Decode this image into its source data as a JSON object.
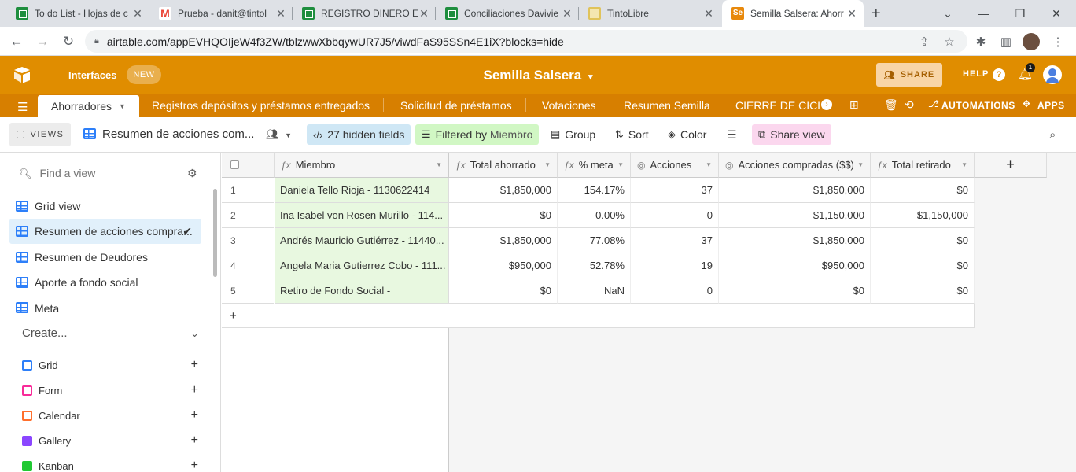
{
  "browser": {
    "tabs": [
      {
        "title": "To do List - Hojas de c",
        "favicon": "sheets-icon"
      },
      {
        "title": "Prueba - danit@tintol",
        "favicon": "gmail-icon"
      },
      {
        "title": "REGISTRO DINERO EN",
        "favicon": "sheets-icon"
      },
      {
        "title": "Conciliaciones Davivie",
        "favicon": "sheets-icon"
      },
      {
        "title": "TintoLibre",
        "favicon": "tintolibre-icon"
      },
      {
        "title": "Semilla Salsera: Ahorr",
        "favicon": "airtable-se-icon"
      }
    ],
    "new_tab": "+",
    "url": "airtable.com/appEVHQOIjeW4f3ZW/tblzwwXbbqywUR7J5/viwdFaS95SSn4E1iX?blocks=hide"
  },
  "header": {
    "interfaces": "Interfaces",
    "new_badge": "NEW",
    "base_title": "Semilla Salsera",
    "base_caret": "▾",
    "share": "SHARE",
    "help": "HELP",
    "notification_count": "1"
  },
  "tables": {
    "active": "Ahorradores",
    "items": [
      "Registros depósitos y préstamos entregados",
      "Solicitud de préstamos",
      "Votaciones",
      "Resumen Semilla",
      "CIERRE DE CICLO"
    ],
    "automations": "AUTOMATIONS",
    "apps": "APPS"
  },
  "viewbar": {
    "views": "VIEWS",
    "view_name": "Resumen de acciones com...",
    "hidden_fields": "27 hidden fields",
    "filtered_prefix": "Filtered by",
    "filtered_field": "Miembro",
    "group": "Group",
    "sort": "Sort",
    "color": "Color",
    "share_view": "Share view"
  },
  "sidebar": {
    "find_placeholder": "Find a view",
    "views": [
      {
        "label": "Grid view",
        "active": false
      },
      {
        "label": "Resumen de acciones compra...",
        "active": true
      },
      {
        "label": "Resumen de Deudores",
        "active": false
      },
      {
        "label": "Aporte a fondo social",
        "active": false
      },
      {
        "label": "Meta",
        "active": false
      }
    ],
    "create_label": "Create...",
    "create_items": [
      {
        "label": "Grid",
        "color": "#2d7ff9"
      },
      {
        "label": "Form",
        "color": "#f82b99"
      },
      {
        "label": "Calendar",
        "color": "#ff6f2c"
      },
      {
        "label": "Gallery",
        "color": "#8b46ff"
      },
      {
        "label": "Kanban",
        "color": "#20c933"
      }
    ]
  },
  "grid": {
    "columns": [
      {
        "name": "Miembro",
        "type": "formula"
      },
      {
        "name": "Total ahorrado",
        "type": "formula"
      },
      {
        "name": "% meta",
        "type": "formula"
      },
      {
        "name": "Acciones",
        "type": "rollup"
      },
      {
        "name": "Acciones compradas ($$)",
        "type": "rollup"
      },
      {
        "name": "Total retirado",
        "type": "formula"
      }
    ],
    "rows": [
      {
        "n": "1",
        "miembro": "Daniela Tello Rioja - 1130622414",
        "total": "$1,850,000",
        "meta": "154.17%",
        "acciones": "37",
        "compradas": "$1,850,000",
        "retirado": "$0"
      },
      {
        "n": "2",
        "miembro": "Ina Isabel von Rosen Murillo - 114...",
        "total": "$0",
        "meta": "0.00%",
        "acciones": "0",
        "compradas": "$1,150,000",
        "retirado": "$1,150,000"
      },
      {
        "n": "3",
        "miembro": "Andrés Mauricio Gutiérrez - 11440...",
        "total": "$1,850,000",
        "meta": "77.08%",
        "acciones": "37",
        "compradas": "$1,850,000",
        "retirado": "$0"
      },
      {
        "n": "4",
        "miembro": "Angela Maria Gutierrez Cobo - 111...",
        "total": "$950,000",
        "meta": "52.78%",
        "acciones": "19",
        "compradas": "$950,000",
        "retirado": "$0"
      },
      {
        "n": "5",
        "miembro": "Retiro de Fondo Social -",
        "total": "$0",
        "meta": "NaN",
        "acciones": "0",
        "compradas": "$0",
        "retirado": "$0"
      }
    ],
    "add_row": "+",
    "add_column": "+"
  }
}
